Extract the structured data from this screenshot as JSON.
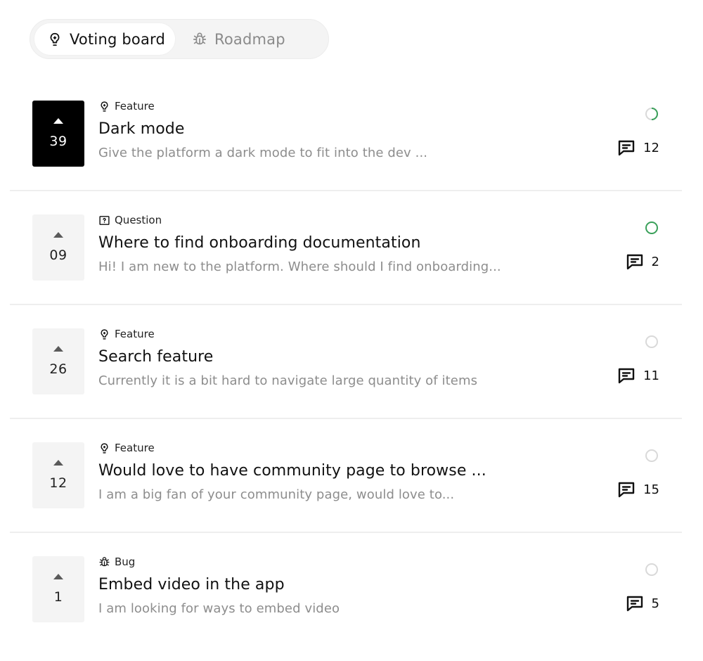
{
  "tabs": [
    {
      "label": "Voting board",
      "icon": "lightbulb-icon",
      "active": true
    },
    {
      "label": "Roadmap",
      "icon": "bug-icon",
      "active": false
    }
  ],
  "colors": {
    "status_green": "#3aa05a",
    "status_empty": "#d9d9d9",
    "vote_active_bg": "#000000",
    "vote_bg": "#f4f4f4"
  },
  "posts": [
    {
      "votes": "39",
      "voted": true,
      "tag": "Feature",
      "tag_icon": "lightbulb-icon",
      "title": "Dark mode",
      "description": "Give the platform a dark mode to fit into the dev ...",
      "status": "in-progress",
      "comments": "12"
    },
    {
      "votes": "09",
      "voted": false,
      "tag": "Question",
      "tag_icon": "question-icon",
      "title": "Where to find onboarding documentation",
      "description": "Hi! I am new to the platform. Where should I find onboarding...",
      "status": "complete",
      "comments": "2"
    },
    {
      "votes": "26",
      "voted": false,
      "tag": "Feature",
      "tag_icon": "lightbulb-icon",
      "title": "Search feature",
      "description": "Currently it is a bit hard to navigate large quantity of items",
      "status": "open",
      "comments": "11"
    },
    {
      "votes": "12",
      "voted": false,
      "tag": "Feature",
      "tag_icon": "lightbulb-icon",
      "title": "Would love to have community page to browse ...",
      "description": "I am a big fan of your community page, would love to...",
      "status": "open",
      "comments": "15"
    },
    {
      "votes": "1",
      "voted": false,
      "tag": "Bug",
      "tag_icon": "bug-icon",
      "title": "Embed video in the app",
      "description": "I am looking for ways to embed video",
      "status": "open",
      "comments": "5"
    }
  ]
}
